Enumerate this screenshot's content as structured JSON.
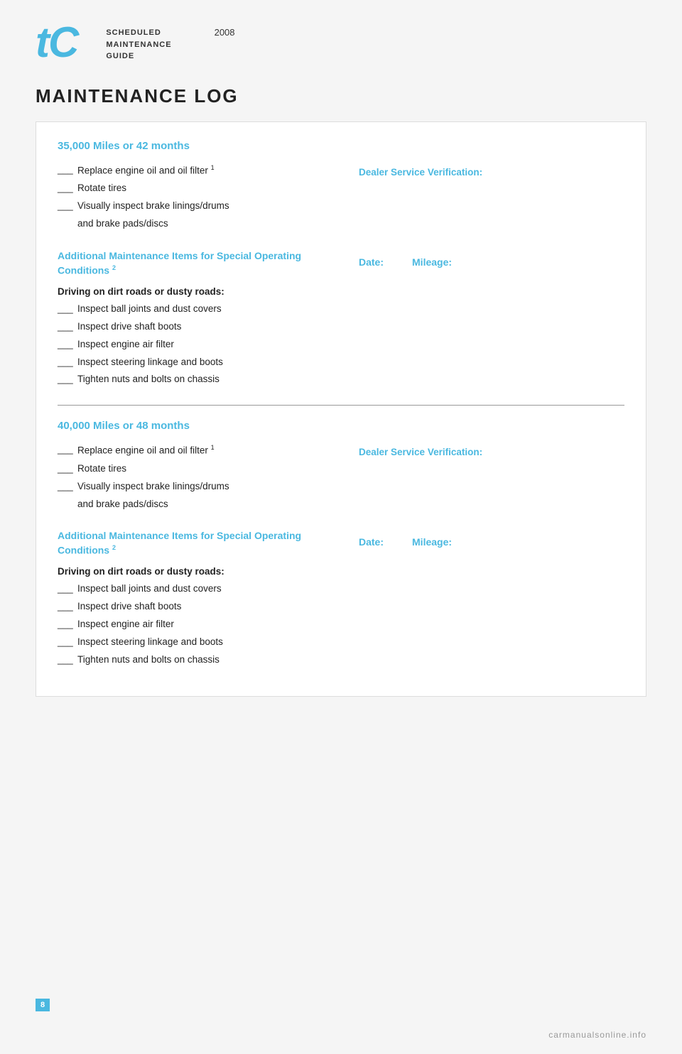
{
  "header": {
    "logo": "tC",
    "title_line1": "SCHEDULED",
    "title_line2": "MAINTENANCE",
    "title_line3": "GUIDE",
    "year": "2008"
  },
  "page_title": "MAINTENANCE LOG",
  "sections": [
    {
      "id": "section-35k",
      "miles_label": "35,000 Miles or 42 months",
      "basic_items": [
        {
          "text": "Replace engine oil and oil filter",
          "sup": "1"
        },
        {
          "text": "Rotate tires",
          "sup": ""
        },
        {
          "text": "Visually inspect brake linings/drums",
          "sup": ""
        },
        {
          "text": "and brake pads/discs",
          "sup": "",
          "indent": true
        }
      ],
      "dealer_label": "Dealer Service Verification:",
      "additional_header": "Additional Maintenance Items for Special Operating Conditions",
      "additional_sup": "2",
      "driving_header": "Driving on dirt roads or dusty roads:",
      "additional_items": [
        "Inspect ball joints and dust covers",
        "Inspect drive shaft boots",
        "Inspect engine air filter",
        "Inspect steering linkage and boots",
        "Tighten nuts and bolts on chassis"
      ],
      "date_label": "Date:",
      "mileage_label": "Mileage:"
    },
    {
      "id": "section-40k",
      "miles_label": "40,000 Miles or 48 months",
      "basic_items": [
        {
          "text": "Replace engine oil and oil filter",
          "sup": "1"
        },
        {
          "text": "Rotate tires",
          "sup": ""
        },
        {
          "text": "Visually inspect brake linings/drums",
          "sup": ""
        },
        {
          "text": "and brake pads/discs",
          "sup": "",
          "indent": true
        }
      ],
      "dealer_label": "Dealer Service Verification:",
      "additional_header": "Additional Maintenance Items for Special Operating Conditions",
      "additional_sup": "2",
      "driving_header": "Driving on dirt roads or dusty roads:",
      "additional_items": [
        "Inspect ball joints and dust covers",
        "Inspect drive shaft boots",
        "Inspect engine air filter",
        "Inspect steering linkage and boots",
        "Tighten nuts and bolts on chassis"
      ],
      "date_label": "Date:",
      "mileage_label": "Mileage:"
    }
  ],
  "page_number": "8",
  "footer_brand": "carmanualsonline.info"
}
